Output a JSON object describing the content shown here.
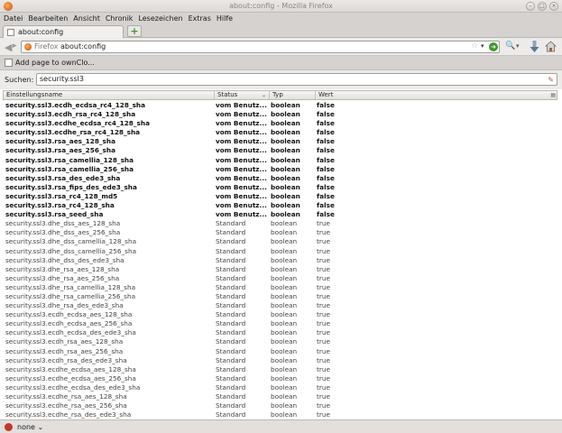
{
  "window": {
    "title": "about:config - Mozilla Firefox"
  },
  "menu": [
    "Datei",
    "Bearbeiten",
    "Ansicht",
    "Chronik",
    "Lesezeichen",
    "Extras",
    "Hilfe"
  ],
  "tab": {
    "label": "about:config",
    "new_tab": "+"
  },
  "navbar": {
    "identity": "Firefox",
    "url": "about:config"
  },
  "bookmarks": {
    "item": "Add page to ownClo..."
  },
  "search": {
    "label": "Suchen:",
    "value": "security.ssl3"
  },
  "columns": {
    "name": "Einstellungsname",
    "status": "Status",
    "type": "Typ",
    "value": "Wert"
  },
  "rows": [
    {
      "name": "security.ssl3.ecdh_ecdsa_rc4_128_sha",
      "status": "vom Benutz...",
      "type": "boolean",
      "value": "false",
      "modified": true
    },
    {
      "name": "security.ssl3.ecdh_rsa_rc4_128_sha",
      "status": "vom Benutz...",
      "type": "boolean",
      "value": "false",
      "modified": true
    },
    {
      "name": "security.ssl3.ecdhe_ecdsa_rc4_128_sha",
      "status": "vom Benutz...",
      "type": "boolean",
      "value": "false",
      "modified": true
    },
    {
      "name": "security.ssl3.ecdhe_rsa_rc4_128_sha",
      "status": "vom Benutz...",
      "type": "boolean",
      "value": "false",
      "modified": true
    },
    {
      "name": "security.ssl3.rsa_aes_128_sha",
      "status": "vom Benutz...",
      "type": "boolean",
      "value": "false",
      "modified": true
    },
    {
      "name": "security.ssl3.rsa_aes_256_sha",
      "status": "vom Benutz...",
      "type": "boolean",
      "value": "false",
      "modified": true
    },
    {
      "name": "security.ssl3.rsa_camellia_128_sha",
      "status": "vom Benutz...",
      "type": "boolean",
      "value": "false",
      "modified": true
    },
    {
      "name": "security.ssl3.rsa_camellia_256_sha",
      "status": "vom Benutz...",
      "type": "boolean",
      "value": "false",
      "modified": true
    },
    {
      "name": "security.ssl3.rsa_des_ede3_sha",
      "status": "vom Benutz...",
      "type": "boolean",
      "value": "false",
      "modified": true
    },
    {
      "name": "security.ssl3.rsa_fips_des_ede3_sha",
      "status": "vom Benutz...",
      "type": "boolean",
      "value": "false",
      "modified": true
    },
    {
      "name": "security.ssl3.rsa_rc4_128_md5",
      "status": "vom Benutz...",
      "type": "boolean",
      "value": "false",
      "modified": true
    },
    {
      "name": "security.ssl3.rsa_rc4_128_sha",
      "status": "vom Benutz...",
      "type": "boolean",
      "value": "false",
      "modified": true
    },
    {
      "name": "security.ssl3.rsa_seed_sha",
      "status": "vom Benutz...",
      "type": "boolean",
      "value": "false",
      "modified": true
    },
    {
      "name": "security.ssl3.dhe_dss_aes_128_sha",
      "status": "Standard",
      "type": "boolean",
      "value": "true",
      "modified": false
    },
    {
      "name": "security.ssl3.dhe_dss_aes_256_sha",
      "status": "Standard",
      "type": "boolean",
      "value": "true",
      "modified": false
    },
    {
      "name": "security.ssl3.dhe_dss_camellia_128_sha",
      "status": "Standard",
      "type": "boolean",
      "value": "true",
      "modified": false
    },
    {
      "name": "security.ssl3.dhe_dss_camellia_256_sha",
      "status": "Standard",
      "type": "boolean",
      "value": "true",
      "modified": false
    },
    {
      "name": "security.ssl3.dhe_dss_des_ede3_sha",
      "status": "Standard",
      "type": "boolean",
      "value": "true",
      "modified": false
    },
    {
      "name": "security.ssl3.dhe_rsa_aes_128_sha",
      "status": "Standard",
      "type": "boolean",
      "value": "true",
      "modified": false
    },
    {
      "name": "security.ssl3.dhe_rsa_aes_256_sha",
      "status": "Standard",
      "type": "boolean",
      "value": "true",
      "modified": false
    },
    {
      "name": "security.ssl3.dhe_rsa_camellia_128_sha",
      "status": "Standard",
      "type": "boolean",
      "value": "true",
      "modified": false
    },
    {
      "name": "security.ssl3.dhe_rsa_camellia_256_sha",
      "status": "Standard",
      "type": "boolean",
      "value": "true",
      "modified": false
    },
    {
      "name": "security.ssl3.dhe_rsa_des_ede3_sha",
      "status": "Standard",
      "type": "boolean",
      "value": "true",
      "modified": false
    },
    {
      "name": "security.ssl3.ecdh_ecdsa_aes_128_sha",
      "status": "Standard",
      "type": "boolean",
      "value": "true",
      "modified": false
    },
    {
      "name": "security.ssl3.ecdh_ecdsa_aes_256_sha",
      "status": "Standard",
      "type": "boolean",
      "value": "true",
      "modified": false
    },
    {
      "name": "security.ssl3.ecdh_ecdsa_des_ede3_sha",
      "status": "Standard",
      "type": "boolean",
      "value": "true",
      "modified": false
    },
    {
      "name": "security.ssl3.ecdh_rsa_aes_128_sha",
      "status": "Standard",
      "type": "boolean",
      "value": "true",
      "modified": false
    },
    {
      "name": "security.ssl3.ecdh_rsa_aes_256_sha",
      "status": "Standard",
      "type": "boolean",
      "value": "true",
      "modified": false
    },
    {
      "name": "security.ssl3.ecdh_rsa_des_ede3_sha",
      "status": "Standard",
      "type": "boolean",
      "value": "true",
      "modified": false
    },
    {
      "name": "security.ssl3.ecdhe_ecdsa_aes_128_sha",
      "status": "Standard",
      "type": "boolean",
      "value": "true",
      "modified": false
    },
    {
      "name": "security.ssl3.ecdhe_ecdsa_aes_256_sha",
      "status": "Standard",
      "type": "boolean",
      "value": "true",
      "modified": false
    },
    {
      "name": "security.ssl3.ecdhe_ecdsa_des_ede3_sha",
      "status": "Standard",
      "type": "boolean",
      "value": "true",
      "modified": false
    },
    {
      "name": "security.ssl3.ecdhe_rsa_aes_128_sha",
      "status": "Standard",
      "type": "boolean",
      "value": "true",
      "modified": false
    },
    {
      "name": "security.ssl3.ecdhe_rsa_aes_256_sha",
      "status": "Standard",
      "type": "boolean",
      "value": "true",
      "modified": false
    },
    {
      "name": "security.ssl3.ecdhe_rsa_des_ede3_sha",
      "status": "Standard",
      "type": "boolean",
      "value": "true",
      "modified": false
    }
  ],
  "statusbar": {
    "label": "none"
  },
  "icons": {
    "app": "firefox-icon",
    "back": "back-arrow-icon",
    "forward": "forward-arrow-icon",
    "bookmark_star": "star-icon",
    "go": "go-arrow-icon",
    "search_engine": "search-engine-icon",
    "downloads": "download-icon",
    "home": "home-icon",
    "clear": "clear-search-icon",
    "column_picker": "column-picker-icon"
  },
  "colors": {
    "go_green": "#3c9a2a",
    "addon_red": "#c0382b",
    "firefox_orange": "#e0621f"
  }
}
